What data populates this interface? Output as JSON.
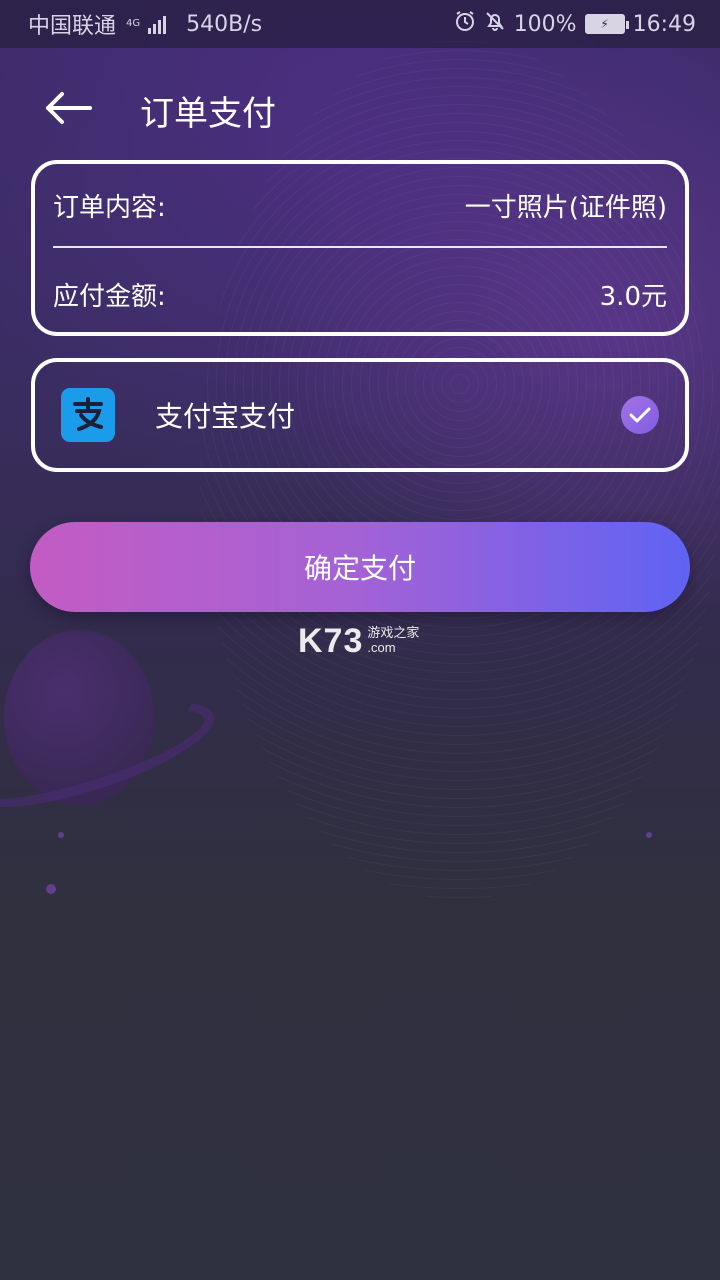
{
  "status_bar": {
    "carrier": "中国联通",
    "network": "4G",
    "speed": "540B/s",
    "battery": "100%",
    "time": "16:49"
  },
  "header": {
    "title": "订单支付",
    "back_icon": "arrow-left-icon"
  },
  "order": {
    "content_label": "订单内容:",
    "content_value": "一寸照片(证件照)",
    "amount_label": "应付金额:",
    "amount_value": "3.0元"
  },
  "payment": {
    "method_label": "支付宝支付",
    "method_icon": "alipay-icon",
    "selected": true
  },
  "actions": {
    "confirm_label": "确定支付"
  },
  "watermark": {
    "brand": "K73",
    "sub_cn": "游戏之家",
    "sub_com": ".com"
  },
  "colors": {
    "accent_start": "#c35cc3",
    "accent_end": "#5f63f3",
    "alipay_blue": "#1b9cea",
    "check_purple": "#8f66e4"
  }
}
